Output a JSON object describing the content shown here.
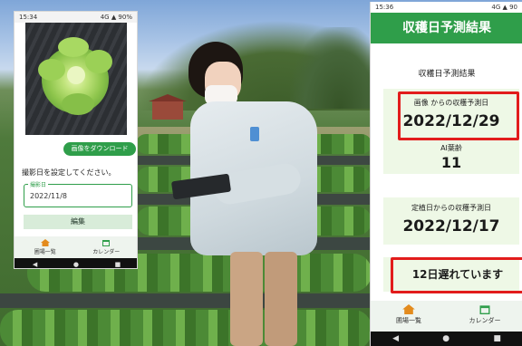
{
  "left_phone": {
    "status_time": "15:34",
    "status_indicators": "4G ▲ 90%",
    "download_button": "画像をダウンロード",
    "instruction": "撮影日を設定してください。",
    "date_field_label": "撮影日",
    "date_field_value": "2022/11/8",
    "edit_button": "編集",
    "tab_home": "圃場一覧",
    "tab_calendar": "カレンダー",
    "nav": [
      "◀",
      "●",
      "■"
    ]
  },
  "right_phone": {
    "status_time": "15:36",
    "status_indicators": "4G ▲ 90",
    "header_title": "収穫日予測結果",
    "section_title": "収穫日予測結果",
    "image_label": "画像 からの収穫予測日",
    "image_date": "2022/12/29",
    "ai_label": "AI葉齢",
    "ai_value": "11",
    "planting_label": "定植日からの収穫予測日",
    "planting_date": "2022/12/17",
    "delay_message": "12日遅れています",
    "tab_home": "圃場一覧",
    "tab_calendar": "カレンダー",
    "nav": [
      "◀",
      "●",
      "■"
    ]
  },
  "colors": {
    "app_green": "#2f9e4a",
    "card_green": "#eef8e6",
    "highlight_red": "#e21c1c"
  },
  "icons": {
    "home": "home-icon",
    "calendar": "calendar-icon"
  }
}
